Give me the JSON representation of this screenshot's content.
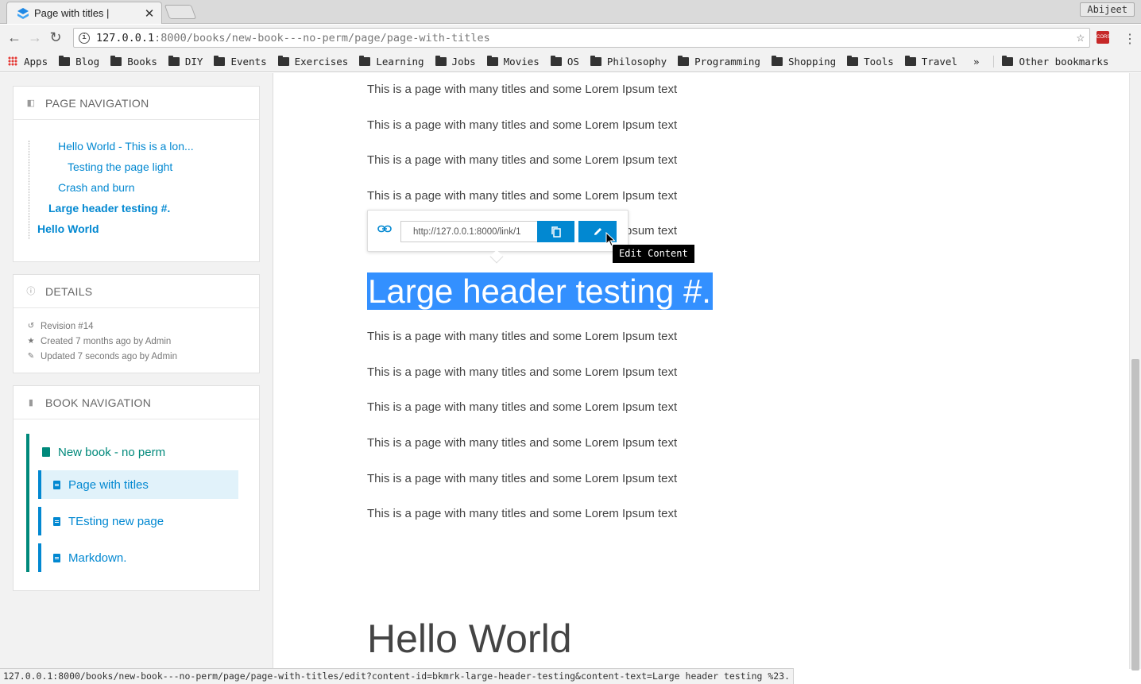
{
  "browser": {
    "tab_title": "Page with titles |",
    "user": "Abijeet",
    "url_host": "127.0.0.1",
    "url_rest": ":8000/books/new-book---no-perm/page/page-with-titles",
    "ext_label": "CORS",
    "bookmarks": [
      "Apps",
      "Blog",
      "Books",
      "DIY",
      "Events",
      "Exercises",
      "Learning",
      "Jobs",
      "Movies",
      "OS",
      "Philosophy",
      "Programming",
      "Shopping",
      "Tools",
      "Travel"
    ],
    "more": "»",
    "other_bookmarks": "Other bookmarks",
    "status_url": "127.0.0.1:8000/books/new-book---no-perm/page/page-with-titles/edit?content-id=bkmrk-large-header-testing&content-text=Large header testing %23."
  },
  "sidebar": {
    "page_nav": {
      "heading": "PAGE NAVIGATION",
      "items": [
        "Hello World - This is a lon...",
        "Testing the page light",
        "Crash and burn",
        "Large header testing #.",
        "Hello World"
      ]
    },
    "details": {
      "heading": "DETAILS",
      "revision": "Revision #14",
      "created": "Created 7 months ago by Admin",
      "updated": "Updated 7 seconds ago by Admin"
    },
    "book_nav": {
      "heading": "BOOK NAVIGATION",
      "book": "New book - no perm",
      "pages": [
        "Page with titles",
        "TEsting new page",
        "Markdown."
      ]
    }
  },
  "content": {
    "paragraph": "This is a page with many titles and some Lorem Ipsum text",
    "partial_paragraph": "psum text",
    "large_header": "Large header testing #.",
    "hello_header": "Hello World",
    "popup": {
      "link_value": "http://127.0.0.1:8000/link/1",
      "tooltip": "Edit Content"
    }
  }
}
